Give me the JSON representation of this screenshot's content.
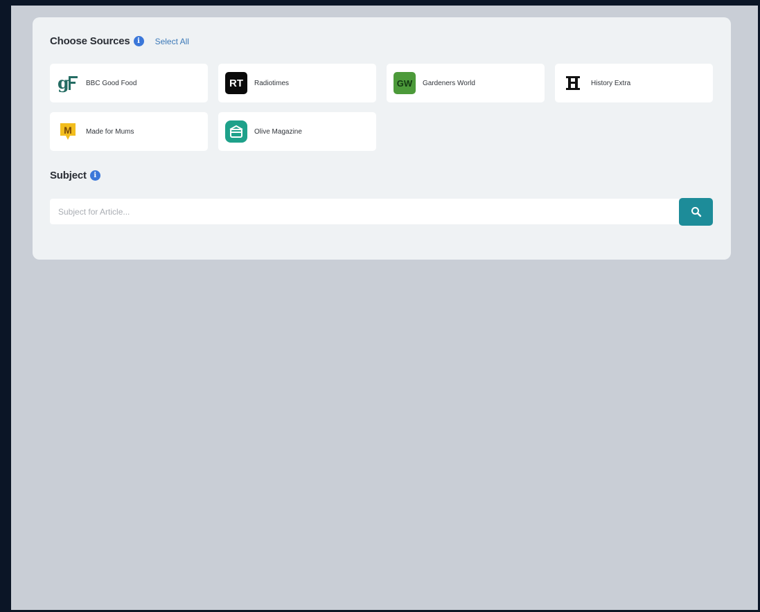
{
  "sources_section": {
    "title": "Choose Sources",
    "info_glyph": "i",
    "select_all_label": "Select All"
  },
  "sources": [
    {
      "label": "BBC Good Food",
      "logo_text": "gF",
      "icon": "bbc-good-food-logo"
    },
    {
      "label": "Radiotimes",
      "logo_text": "RT",
      "icon": "radiotimes-logo"
    },
    {
      "label": "Gardeners World",
      "logo_text": "GW",
      "icon": "gardeners-world-logo"
    },
    {
      "label": "History Extra",
      "logo_text": "H",
      "icon": "history-extra-logo"
    },
    {
      "label": "Made for Mums",
      "logo_text": "M",
      "icon": "made-for-mums-logo"
    },
    {
      "label": "Olive Magazine",
      "logo_text": "",
      "icon": "olive-magazine-logo"
    }
  ],
  "subject_section": {
    "title": "Subject",
    "info_glyph": "i",
    "placeholder": "Subject for Article...",
    "value": ""
  },
  "search_button": {
    "icon": "search-icon"
  },
  "colors": {
    "accent": "#1d8c99",
    "info": "#3b77d9",
    "link": "#3c79b8",
    "panel_bg": "#eff2f4",
    "page_bg": "#c9ced6"
  }
}
